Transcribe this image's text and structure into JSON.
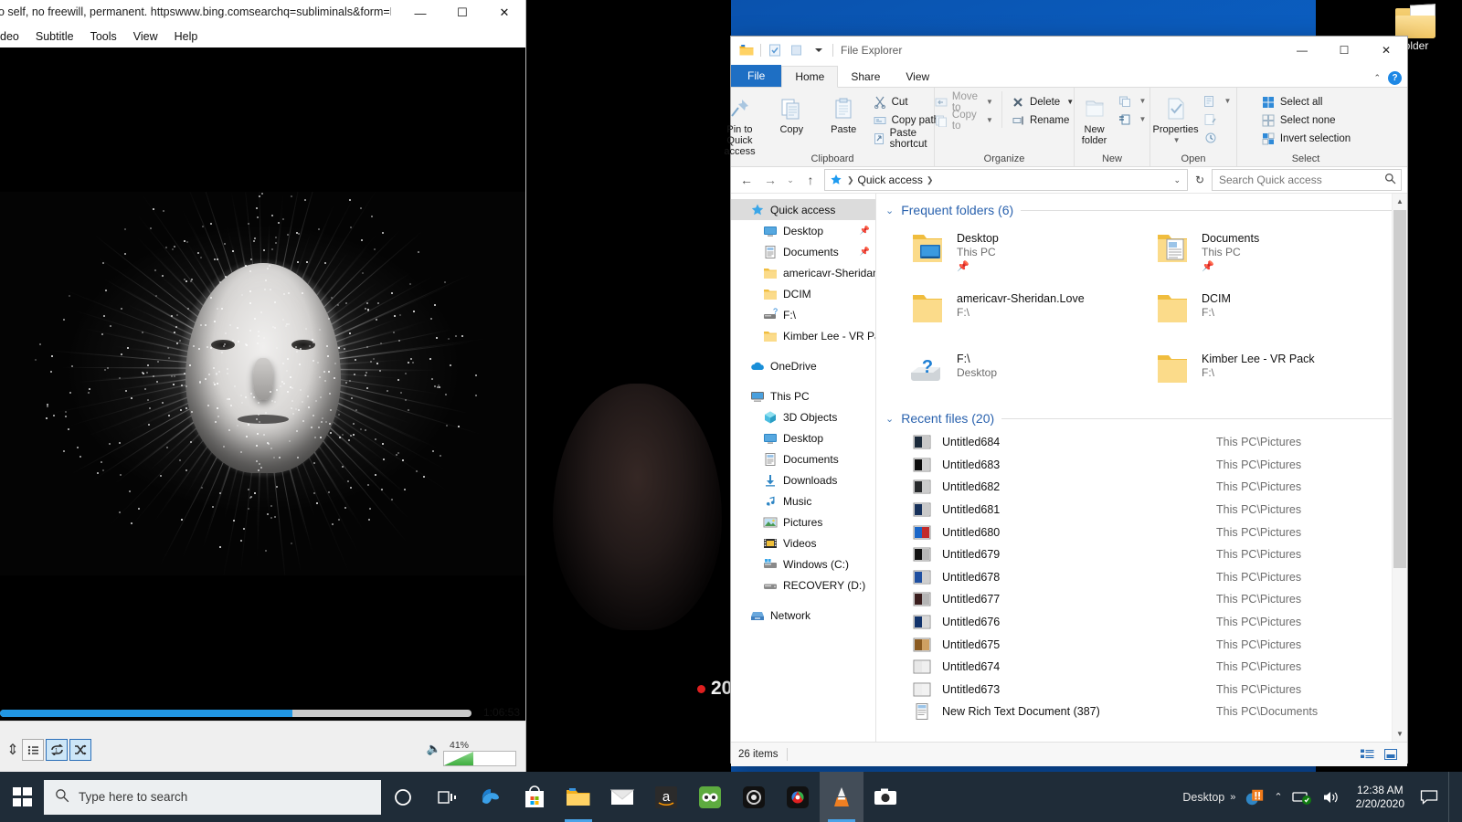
{
  "player": {
    "title": "o self, no freewill, permanent. httpswww.bing.comsearchq=subliminals&form=ED...",
    "menu": [
      "deo",
      "Subtitle",
      "Tools",
      "View",
      "Help"
    ],
    "window_buttons": {
      "minimize": "—",
      "maximize": "☐",
      "close": "✕"
    },
    "time_elapsed": "1:06:53",
    "progress_percent": 62,
    "volume_label": "41%",
    "volume_percent": 41,
    "controls": [
      {
        "name": "playlist-button",
        "glyph": "☰",
        "state": "off"
      },
      {
        "name": "loop-one-button",
        "glyph": "↻",
        "state": "on"
      },
      {
        "name": "shuffle-button",
        "glyph": "⤬",
        "state": "on"
      }
    ]
  },
  "desktop": {
    "icon_label": "older",
    "overlay_number": "20"
  },
  "explorer": {
    "app_title": "File Explorer",
    "quick_access_toolbar": [
      "folder-icon",
      "properties-icon",
      "new-folder-icon",
      "customize-dropdown"
    ],
    "window_buttons": {
      "minimize": "—",
      "maximize": "☐",
      "close": "✕"
    },
    "tabs": [
      {
        "label": "File",
        "type": "file"
      },
      {
        "label": "Home",
        "type": "active"
      },
      {
        "label": "Share",
        "type": "normal"
      },
      {
        "label": "View",
        "type": "normal"
      }
    ],
    "ribbon": {
      "groups": [
        {
          "label": "Clipboard",
          "big_buttons": [
            {
              "label": "Pin to Quick access",
              "icon": "pin-icon"
            },
            {
              "label": "Copy",
              "icon": "copy-icon"
            },
            {
              "label": "Paste",
              "icon": "paste-icon"
            }
          ],
          "small_buttons": [
            {
              "label": "Cut",
              "icon": "scissors-icon",
              "dim": false
            },
            {
              "label": "Copy path",
              "icon": "copy-path-icon",
              "dim": false
            },
            {
              "label": "Paste shortcut",
              "icon": "paste-shortcut-icon",
              "dim": false
            }
          ]
        },
        {
          "label": "Organize",
          "small_buttons": [
            {
              "label": "Move to",
              "icon": "move-to-icon",
              "dim": true,
              "caret": true
            },
            {
              "label": "Copy to",
              "icon": "copy-to-icon",
              "dim": true,
              "caret": true
            },
            {
              "label": "Delete",
              "icon": "delete-icon",
              "dim": false,
              "caret": true
            },
            {
              "label": "Rename",
              "icon": "rename-icon",
              "dim": false,
              "caret": false
            }
          ]
        },
        {
          "label": "New",
          "big_buttons": [
            {
              "label": "New folder",
              "icon": "new-folder-icon"
            }
          ],
          "small_buttons": [
            {
              "label": "",
              "icon": "new-item-icon",
              "caret": true
            },
            {
              "label": "",
              "icon": "easy-access-icon",
              "caret": true
            }
          ]
        },
        {
          "label": "Open",
          "big_buttons": [
            {
              "label": "Properties",
              "icon": "properties-icon"
            }
          ],
          "small_buttons": [
            {
              "label": "",
              "icon": "open-with-icon",
              "caret": true
            },
            {
              "label": "",
              "icon": "edit-icon",
              "caret": false
            },
            {
              "label": "",
              "icon": "history-icon",
              "caret": false
            }
          ]
        },
        {
          "label": "Select",
          "small_buttons": [
            {
              "label": "Select all",
              "icon": "select-all-icon",
              "dim": false
            },
            {
              "label": "Select none",
              "icon": "select-none-icon",
              "dim": false
            },
            {
              "label": "Invert selection",
              "icon": "invert-selection-icon",
              "dim": false
            }
          ]
        }
      ]
    },
    "address": {
      "breadcrumb": "Quick access",
      "back": "←",
      "forward": "→",
      "recent": "⌄",
      "up": "↑",
      "dropdown": "⌄",
      "refresh": "↻"
    },
    "search": {
      "placeholder": "Search Quick access",
      "value": ""
    },
    "nav_pane": {
      "groups": [
        {
          "items": [
            {
              "label": "Quick access",
              "icon": "star-icon",
              "selected": true,
              "indent": false,
              "pin": false
            },
            {
              "label": "Desktop",
              "icon": "desktop-icon",
              "indent": true,
              "pin": true
            },
            {
              "label": "Documents",
              "icon": "documents-icon",
              "indent": true,
              "pin": true
            },
            {
              "label": "americavr-Sheridan.",
              "icon": "folder-icon",
              "indent": true,
              "pin": false
            },
            {
              "label": "DCIM",
              "icon": "folder-icon",
              "indent": true,
              "pin": false
            },
            {
              "label": "F:\\",
              "icon": "drive-unknown-icon",
              "indent": true,
              "pin": false
            },
            {
              "label": "Kimber Lee - VR Pac",
              "icon": "folder-icon",
              "indent": true,
              "pin": false
            }
          ]
        },
        {
          "items": [
            {
              "label": "OneDrive",
              "icon": "onedrive-icon",
              "indent": false,
              "pin": false
            }
          ]
        },
        {
          "items": [
            {
              "label": "This PC",
              "icon": "thispc-icon",
              "indent": false,
              "pin": false
            },
            {
              "label": "3D Objects",
              "icon": "3dobjects-icon",
              "indent": true,
              "pin": false
            },
            {
              "label": "Desktop",
              "icon": "desktop-icon",
              "indent": true,
              "pin": false
            },
            {
              "label": "Documents",
              "icon": "documents-icon",
              "indent": true,
              "pin": false
            },
            {
              "label": "Downloads",
              "icon": "downloads-icon",
              "indent": true,
              "pin": false
            },
            {
              "label": "Music",
              "icon": "music-icon",
              "indent": true,
              "pin": false
            },
            {
              "label": "Pictures",
              "icon": "pictures-icon",
              "indent": true,
              "pin": false
            },
            {
              "label": "Videos",
              "icon": "videos-icon",
              "indent": true,
              "pin": false
            },
            {
              "label": "Windows (C:)",
              "icon": "drive-windows-icon",
              "indent": true,
              "pin": false
            },
            {
              "label": "RECOVERY (D:)",
              "icon": "drive-icon",
              "indent": true,
              "pin": false
            }
          ]
        },
        {
          "items": [
            {
              "label": "Network",
              "icon": "network-icon",
              "indent": false,
              "pin": false
            }
          ]
        }
      ]
    },
    "frequent_folders": {
      "heading": "Frequent folders (6)",
      "items": [
        {
          "name": "Desktop",
          "location": "This PC",
          "pinned": true,
          "icon": "folder-desktop-icon"
        },
        {
          "name": "Documents",
          "location": "This PC",
          "pinned": true,
          "icon": "folder-documents-icon"
        },
        {
          "name": "americavr-Sheridan.Love",
          "location": "F:\\",
          "pinned": false,
          "icon": "folder-icon"
        },
        {
          "name": "DCIM",
          "location": "F:\\",
          "pinned": false,
          "icon": "folder-icon"
        },
        {
          "name": "F:\\",
          "location": "Desktop",
          "pinned": false,
          "icon": "drive-unknown-icon"
        },
        {
          "name": "Kimber Lee - VR Pack",
          "location": "F:\\",
          "pinned": false,
          "icon": "folder-icon"
        }
      ]
    },
    "recent_files": {
      "heading": "Recent files (20)",
      "items": [
        {
          "name": "Untitled684",
          "location": "This PC\\Pictures",
          "icon": "image-thumb-icon"
        },
        {
          "name": "Untitled683",
          "location": "This PC\\Pictures",
          "icon": "image-thumb-icon"
        },
        {
          "name": "Untitled682",
          "location": "This PC\\Pictures",
          "icon": "image-thumb-icon"
        },
        {
          "name": "Untitled681",
          "location": "This PC\\Pictures",
          "icon": "image-thumb-icon"
        },
        {
          "name": "Untitled680",
          "location": "This PC\\Pictures",
          "icon": "image-thumb-icon"
        },
        {
          "name": "Untitled679",
          "location": "This PC\\Pictures",
          "icon": "image-thumb-icon"
        },
        {
          "name": "Untitled678",
          "location": "This PC\\Pictures",
          "icon": "image-thumb-icon"
        },
        {
          "name": "Untitled677",
          "location": "This PC\\Pictures",
          "icon": "image-thumb-icon"
        },
        {
          "name": "Untitled676",
          "location": "This PC\\Pictures",
          "icon": "image-thumb-icon"
        },
        {
          "name": "Untitled675",
          "location": "This PC\\Pictures",
          "icon": "image-thumb-icon"
        },
        {
          "name": "Untitled674",
          "location": "This PC\\Pictures",
          "icon": "image-thumb-icon"
        },
        {
          "name": "Untitled673",
          "location": "This PC\\Pictures",
          "icon": "image-thumb-icon"
        },
        {
          "name": "New Rich Text Document (387)",
          "location": "This PC\\Documents",
          "icon": "rtf-icon"
        }
      ]
    },
    "status": {
      "items_text": "26 items"
    }
  },
  "taskbar": {
    "search_placeholder": "Type here to search",
    "buttons": [
      {
        "name": "cortana-icon",
        "active": false
      },
      {
        "name": "task-view-icon",
        "active": false
      },
      {
        "name": "edge-icon",
        "active": false
      },
      {
        "name": "microsoft-store-icon",
        "active": false
      },
      {
        "name": "file-explorer-icon",
        "active": false,
        "running": true
      },
      {
        "name": "mail-icon",
        "active": false
      },
      {
        "name": "amazon-icon",
        "active": false
      },
      {
        "name": "tripadvisor-icon",
        "active": false
      },
      {
        "name": "dark-app-icon",
        "active": false
      },
      {
        "name": "color-app-icon",
        "active": false
      },
      {
        "name": "vlc-icon",
        "active": true,
        "running": true
      },
      {
        "name": "camera-icon",
        "active": false
      }
    ],
    "tray": {
      "desktop_label": "Desktop",
      "overflow": "⌃",
      "time": "12:38 AM",
      "date": "2/20/2020"
    }
  },
  "colors": {
    "accent_blue": "#1e6fc4",
    "taskbar": "#1f2c38",
    "seek_fill": "#2196e3",
    "link_blue": "#2a62ae"
  }
}
